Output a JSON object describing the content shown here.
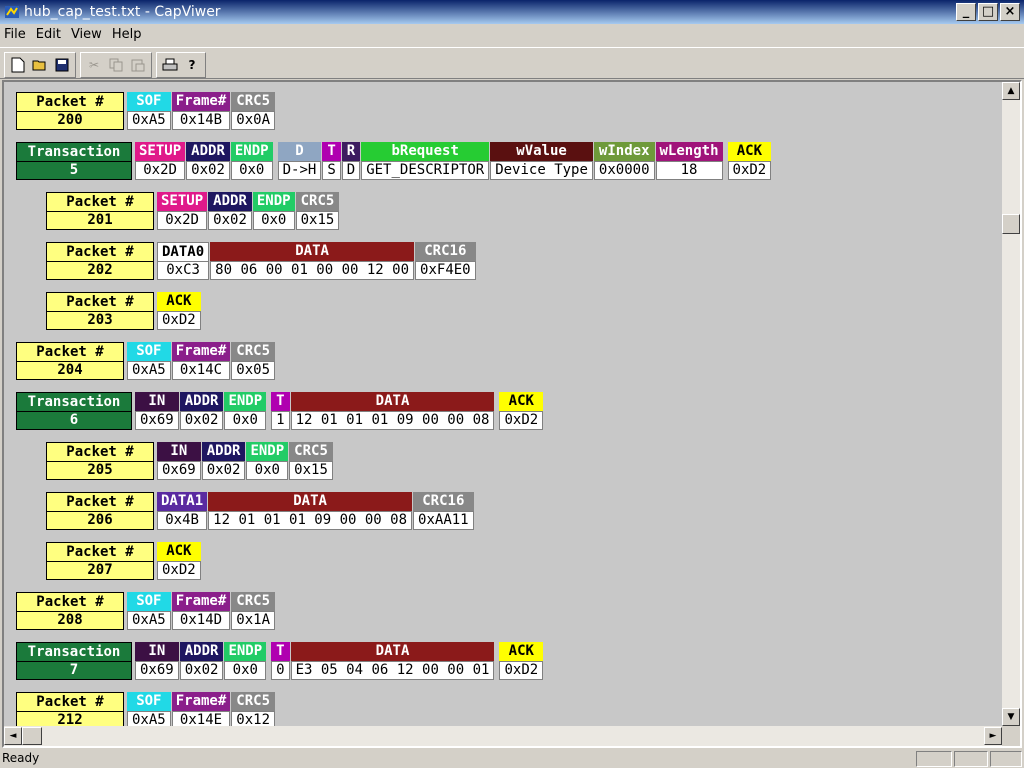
{
  "window": {
    "title": "hub_cap_test.txt - CapViwer",
    "buttons": [
      "_",
      "□",
      "×"
    ]
  },
  "menu": [
    "File",
    "Edit",
    "View",
    "Help"
  ],
  "toolbar": {
    "icons": [
      "new-icon",
      "open-icon",
      "save-icon",
      "cut-icon",
      "copy-icon",
      "paste-icon",
      "print-icon",
      "help-icon"
    ]
  },
  "colors": {
    "packet_label": "#ffff80",
    "transaction_label": "#1b7a3b",
    "sof": "#21d9e6",
    "setup": "#e0198a",
    "ack": "#ffff00",
    "data": "#8b1a1a"
  },
  "records": {
    "p200": {
      "label": "Packet #",
      "num": "200",
      "fields": [
        [
          "SOF",
          "0xA5"
        ],
        [
          "Frame#",
          "0x14B"
        ],
        [
          "CRC5",
          "0x0A"
        ]
      ]
    },
    "t5": {
      "label": "Transaction",
      "num": "5",
      "tok": [
        [
          "SETUP",
          "0x2D"
        ],
        [
          "ADDR",
          "0x02"
        ],
        [
          "ENDP",
          "0x0"
        ]
      ],
      "req": [
        [
          "D",
          "D->H"
        ],
        [
          "T",
          "S"
        ],
        [
          "R",
          "D"
        ],
        [
          "bRequest",
          "GET_DESCRIPTOR"
        ],
        [
          "wValue",
          "Device Type"
        ],
        [
          "wIndex",
          "0x0000"
        ],
        [
          "wLength",
          "18"
        ]
      ],
      "ack": [
        "ACK",
        "0xD2"
      ]
    },
    "p201": {
      "label": "Packet #",
      "num": "201",
      "fields": [
        [
          "SETUP",
          "0x2D"
        ],
        [
          "ADDR",
          "0x02"
        ],
        [
          "ENDP",
          "0x0"
        ],
        [
          "CRC5",
          "0x15"
        ]
      ]
    },
    "p202": {
      "label": "Packet #",
      "num": "202",
      "fields": [
        [
          "DATA0",
          "0xC3"
        ],
        [
          "DATA",
          "80 06 00 01 00 00 12 00"
        ],
        [
          "CRC16",
          "0xF4E0"
        ]
      ]
    },
    "p203": {
      "label": "Packet #",
      "num": "203",
      "fields": [
        [
          "ACK",
          "0xD2"
        ]
      ]
    },
    "p204": {
      "label": "Packet #",
      "num": "204",
      "fields": [
        [
          "SOF",
          "0xA5"
        ],
        [
          "Frame#",
          "0x14C"
        ],
        [
          "CRC5",
          "0x05"
        ]
      ]
    },
    "t6": {
      "label": "Transaction",
      "num": "6",
      "tok": [
        [
          "IN",
          "0x69"
        ],
        [
          "ADDR",
          "0x02"
        ],
        [
          "ENDP",
          "0x0"
        ]
      ],
      "data": [
        [
          "T",
          "1"
        ],
        [
          "DATA",
          "12 01 01 01 09 00 00 08"
        ]
      ],
      "ack": [
        "ACK",
        "0xD2"
      ]
    },
    "p205": {
      "label": "Packet #",
      "num": "205",
      "fields": [
        [
          "IN",
          "0x69"
        ],
        [
          "ADDR",
          "0x02"
        ],
        [
          "ENDP",
          "0x0"
        ],
        [
          "CRC5",
          "0x15"
        ]
      ]
    },
    "p206": {
      "label": "Packet #",
      "num": "206",
      "fields": [
        [
          "DATA1",
          "0x4B"
        ],
        [
          "DATA",
          "12 01 01 01 09 00 00 08"
        ],
        [
          "CRC16",
          "0xAA11"
        ]
      ]
    },
    "p207": {
      "label": "Packet #",
      "num": "207",
      "fields": [
        [
          "ACK",
          "0xD2"
        ]
      ]
    },
    "p208": {
      "label": "Packet #",
      "num": "208",
      "fields": [
        [
          "SOF",
          "0xA5"
        ],
        [
          "Frame#",
          "0x14D"
        ],
        [
          "CRC5",
          "0x1A"
        ]
      ]
    },
    "t7": {
      "label": "Transaction",
      "num": "7",
      "tok": [
        [
          "IN",
          "0x69"
        ],
        [
          "ADDR",
          "0x02"
        ],
        [
          "ENDP",
          "0x0"
        ]
      ],
      "data": [
        [
          "T",
          "0"
        ],
        [
          "DATA",
          "E3 05 04 06 12 00 00 01"
        ]
      ],
      "ack": [
        "ACK",
        "0xD2"
      ]
    },
    "p212": {
      "label": "Packet #",
      "num": "212",
      "fields": [
        [
          "SOF",
          "0xA5"
        ],
        [
          "Frame#",
          "0x14E"
        ],
        [
          "CRC5",
          "0x12"
        ]
      ]
    }
  },
  "status": {
    "text": "Ready"
  }
}
